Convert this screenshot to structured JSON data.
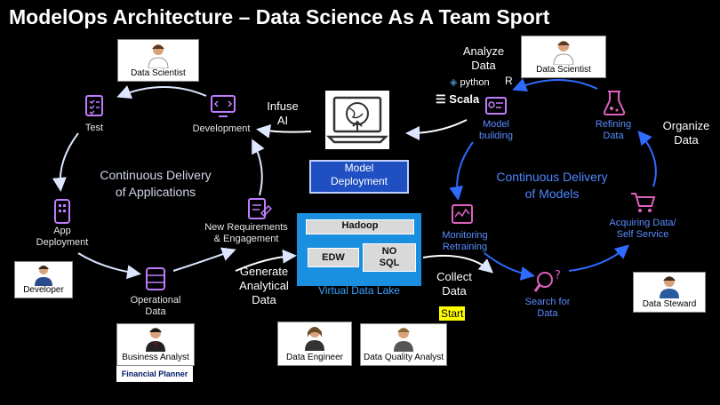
{
  "title": "ModelOps Architecture – Data Science As A Team Sport",
  "left_cycle": {
    "heading_line1": "Continuous Delivery",
    "heading_line2": "of Applications",
    "nodes": {
      "test": "Test",
      "development": "Development",
      "app_deployment_1": "App",
      "app_deployment_2": "Deployment",
      "operational_data_1": "Operational",
      "operational_data_2": "Data",
      "new_req_1": "New Requirements",
      "new_req_2": "& Engagement"
    }
  },
  "right_cycle": {
    "heading_line1": "Continuous Delivery",
    "heading_line2": "of Models",
    "nodes": {
      "model_building_1": "Model",
      "model_building_2": "building",
      "refining_1": "Refining",
      "refining_2": "Data",
      "monitoring_1": "Monitoring",
      "monitoring_2": "Retraining",
      "acquiring_1": "Acquiring Data/",
      "acquiring_2": "Self Service",
      "search_1": "Search for",
      "search_2": "Data"
    }
  },
  "center": {
    "infuse_1": "Infuse",
    "infuse_2": "AI",
    "model_deployment_1": "Model",
    "model_deployment_2": "Deployment",
    "hadoop": "Hadoop",
    "edw": "EDW",
    "nosql_1": "NO",
    "nosql_2": "SQL",
    "virtual_data_lake": "Virtual Data Lake",
    "generate_1": "Generate",
    "generate_2": "Analytical",
    "generate_3": "Data",
    "collect_1": "Collect",
    "collect_2": "Data",
    "start": "Start"
  },
  "side_labels": {
    "analyze_1": "Analyze",
    "analyze_2": "Data",
    "organize_1": "Organize",
    "organize_2": "Data",
    "python": "python",
    "r": "R",
    "scala": "Scala"
  },
  "roles": {
    "data_scientist_left": "Data Scientist",
    "data_scientist_right": "Data Scientist",
    "developer": "Developer",
    "business_analyst": "Business Analyst",
    "financial_planner": "Financial Planner",
    "data_engineer": "Data Engineer",
    "data_quality_analyst": "Data Quality Analyst",
    "data_steward": "Data Steward"
  },
  "colors": {
    "background": "#000000",
    "left_cycle_arrow": "#dce6ff",
    "right_cycle_arrow": "#2f6bff",
    "icon_purple": "#c07cff",
    "lake_blue": "#1a8fe0",
    "model_deployment_blue": "#1f4fc0",
    "start_highlight": "#ffff00"
  }
}
